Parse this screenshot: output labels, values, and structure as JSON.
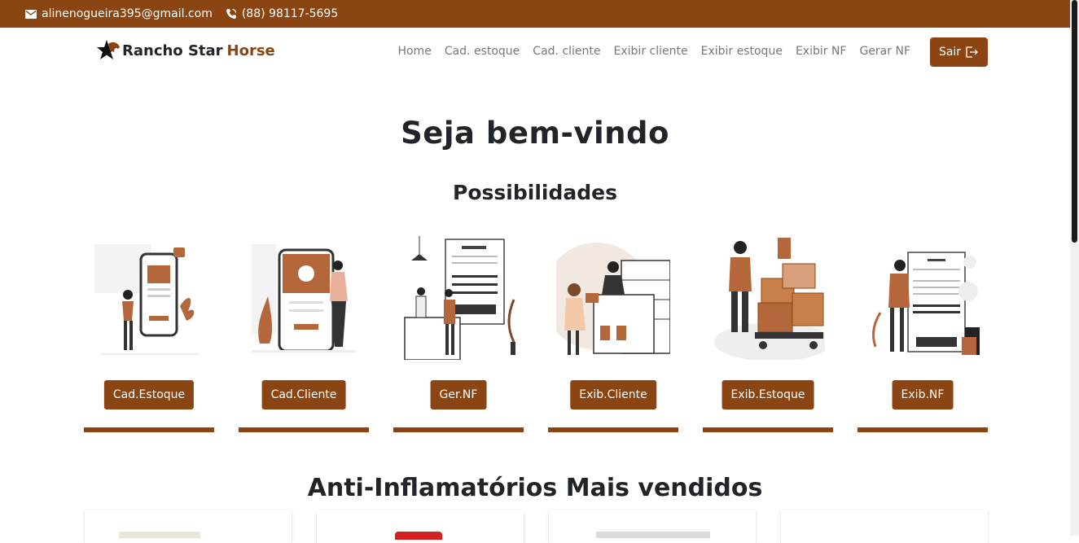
{
  "topbar": {
    "email": "alinenogueira395@gmail.com",
    "phone": "(88) 98117-5695",
    "email_icon": "mail-icon",
    "phone_icon": "phone-icon"
  },
  "brand": {
    "name": "Rancho Star",
    "accent": "Horse",
    "logo_icon": "star-horse-icon"
  },
  "nav": {
    "home": "Home",
    "cad_estoque": "Cad. estoque",
    "cad_cliente": "Cad. cliente",
    "exibir_cliente": "Exibir cliente",
    "exibir_estoque": "Exibir estoque",
    "exibir_nf": "Exibir NF",
    "gerar_nf": "Gerar NF",
    "sair": "Sair",
    "sair_icon": "logout-icon"
  },
  "hero": {
    "title": "Seja bem-vindo",
    "subtitle": "Possibilidades"
  },
  "cards": [
    {
      "label": "Cad.Estoque"
    },
    {
      "label": "Cad.Cliente"
    },
    {
      "label": "Ger.NF"
    },
    {
      "label": "Exib.Cliente"
    },
    {
      "label": "Exib.Estoque"
    },
    {
      "label": "Exib.NF"
    }
  ],
  "products": {
    "title": "Anti-Inflamatórios Mais vendidos"
  },
  "colors": {
    "brand": "#8b4513",
    "text": "#212529",
    "nav": "#777777"
  }
}
